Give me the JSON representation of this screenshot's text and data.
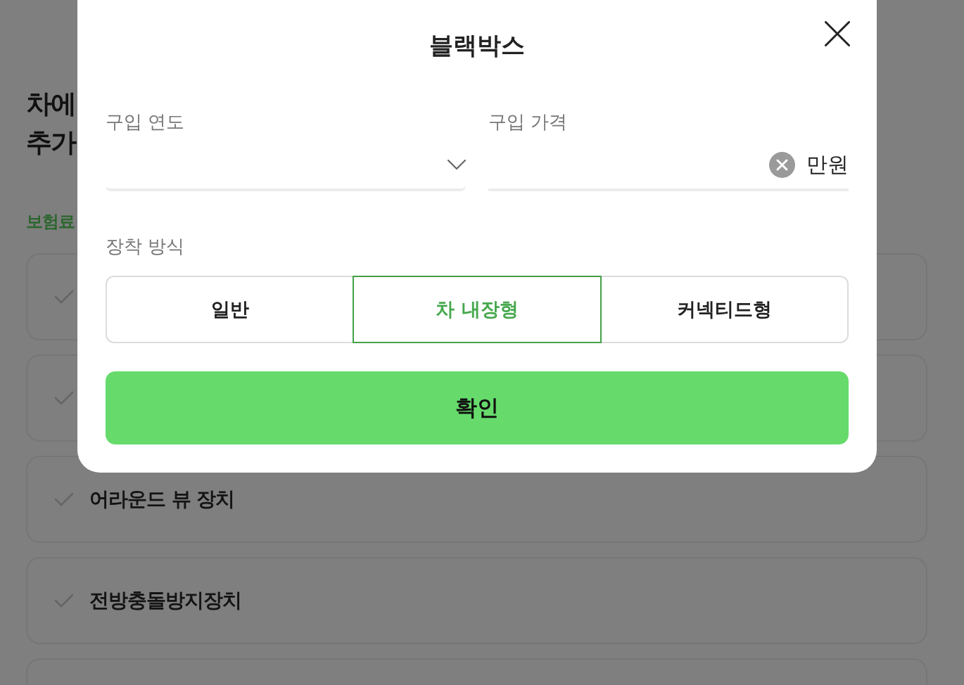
{
  "background_page": {
    "heading_lines": [
      "차에",
      "추가"
    ],
    "section_label": "보험료",
    "options": [
      {
        "checked": false
      },
      {
        "checked": false
      },
      {
        "checked": false,
        "label": "어라운드 뷰 장치"
      },
      {
        "checked": false,
        "label": "전방충돌방지장치"
      }
    ],
    "more_below": true
  },
  "dialog": {
    "title": "블랙박스",
    "fields": [
      {
        "kind": "select",
        "label": "구입 연도"
      },
      {
        "kind": "amount",
        "label": "구입 가격",
        "unit": "만원"
      }
    ],
    "mount_type": {
      "label": "장착 방식",
      "options": [
        {
          "label": "일반",
          "selected": false
        },
        {
          "label": "차 내장형",
          "selected": true
        },
        {
          "label": "커넥티드형",
          "selected": false
        }
      ]
    },
    "confirm_button": "확인"
  }
}
